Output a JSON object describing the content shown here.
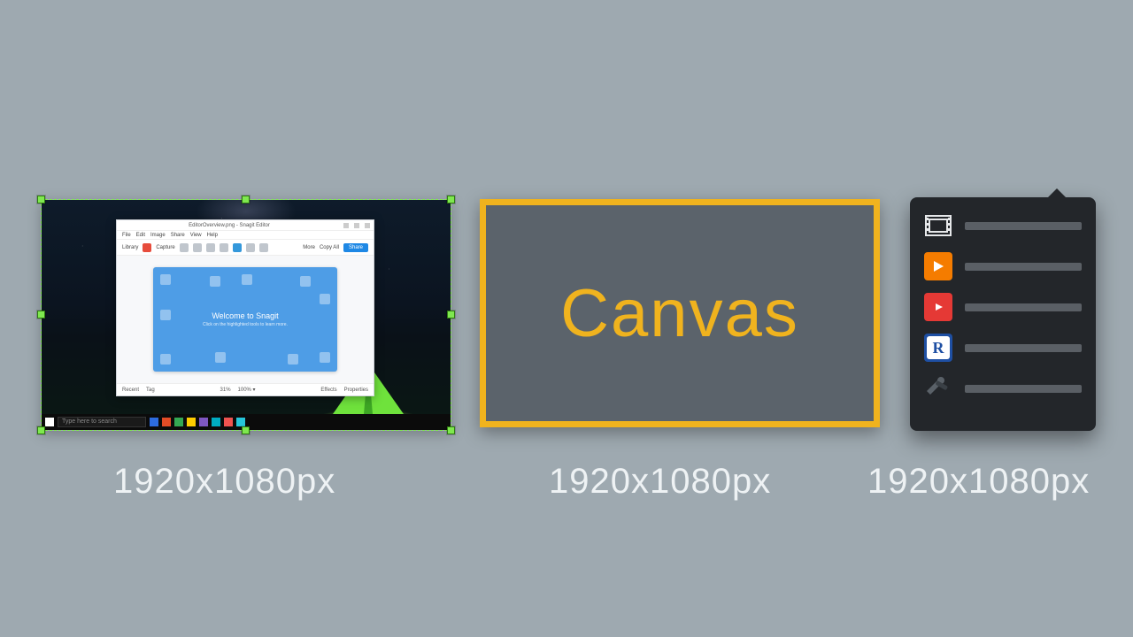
{
  "captions": {
    "panel1": "1920x1080px",
    "panel2": "1920x1080px",
    "panel3": "1920x1080px"
  },
  "panel2": {
    "label": "Canvas"
  },
  "panel1": {
    "taskbar_search_placeholder": "Type here to search",
    "editor": {
      "menus": [
        "File",
        "Edit",
        "Image",
        "Share",
        "View",
        "Help"
      ],
      "title_center": "EditorOverview.png - Snagit Editor",
      "toolbar": {
        "library": "Library",
        "capture": "Capture",
        "more": "More",
        "copy_all": "Copy All",
        "share": "Share"
      },
      "welcome_title": "Welcome to Snagit",
      "welcome_sub": "Click on the highlighted tools to learn more.",
      "status": {
        "recent": "Recent",
        "tag": "Tag",
        "zoom": "31%",
        "fit": "100% ▾",
        "effects": "Effects",
        "properties": "Properties"
      }
    }
  },
  "panel3": {
    "items": [
      {
        "icon": "film"
      },
      {
        "icon": "play"
      },
      {
        "icon": "youtube"
      },
      {
        "icon": "r"
      },
      {
        "icon": "tools"
      }
    ]
  }
}
